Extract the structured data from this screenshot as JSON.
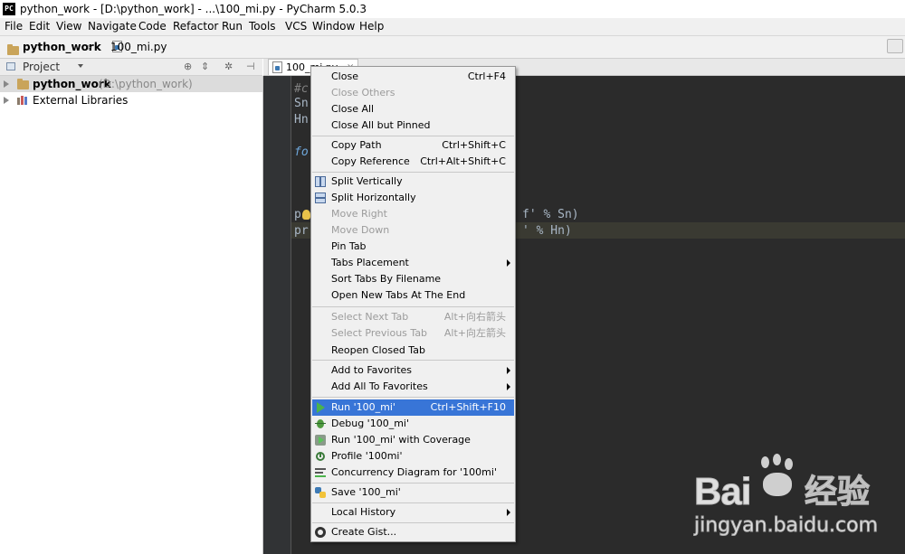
{
  "window": {
    "title": "python_work - [D:\\python_work] - ...\\100_mi.py - PyCharm 5.0.3",
    "app_icon": "PC"
  },
  "menubar": {
    "items": [
      "File",
      "Edit",
      "View",
      "Navigate",
      "Code",
      "Refactor",
      "Run",
      "Tools",
      "VCS",
      "Window",
      "Help"
    ]
  },
  "breadcrumb": {
    "project": "python_work",
    "file": "100_mi.py"
  },
  "project_panel": {
    "label": "Project",
    "tree": [
      {
        "name": "python_work",
        "path": "(D:\\python_work)"
      },
      {
        "name": "External Libraries"
      }
    ]
  },
  "editor": {
    "tab_label": "100_mi.py",
    "code_lines": [
      "#c",
      "Sn",
      "Hn",
      "",
      "fo",
      "",
      "",
      "",
      "p",
      "pr"
    ],
    "right_fragments": [
      "f' % Sn)",
      "' % Hn)"
    ]
  },
  "context_menu": {
    "groups": [
      [
        {
          "label": "Close",
          "shortcut": "Ctrl+F4"
        },
        {
          "label": "Close Others",
          "disabled": true
        },
        {
          "label": "Close All"
        },
        {
          "label": "Close All but Pinned"
        }
      ],
      [
        {
          "label": "Copy Path",
          "shortcut": "Ctrl+Shift+C"
        },
        {
          "label": "Copy Reference",
          "shortcut": "Ctrl+Alt+Shift+C"
        }
      ],
      [
        {
          "label": "Split Vertically",
          "icon": "split-vertical-icon"
        },
        {
          "label": "Split Horizontally",
          "icon": "split-horizontal-icon"
        },
        {
          "label": "Move Right",
          "disabled": true
        },
        {
          "label": "Move Down",
          "disabled": true
        },
        {
          "label": "Pin Tab"
        },
        {
          "label": "Tabs Placement",
          "submenu": true
        },
        {
          "label": "Sort Tabs By Filename"
        },
        {
          "label": "Open New Tabs At The End"
        }
      ],
      [
        {
          "label": "Select Next Tab",
          "shortcut": "Alt+向右箭头",
          "disabled": true
        },
        {
          "label": "Select Previous Tab",
          "shortcut": "Alt+向左箭头",
          "disabled": true
        },
        {
          "label": "Reopen Closed Tab"
        }
      ],
      [
        {
          "label": "Add to Favorites",
          "submenu": true
        },
        {
          "label": "Add All To Favorites",
          "submenu": true
        }
      ],
      [
        {
          "label": "Run '100_mi'",
          "shortcut": "Ctrl+Shift+F10",
          "highlighted": true,
          "icon": "run-icon"
        },
        {
          "label": "Debug '100_mi'",
          "icon": "debug-icon"
        },
        {
          "label": "Run '100_mi' with Coverage",
          "icon": "coverage-icon"
        },
        {
          "label": "Profile '100mi'",
          "icon": "profile-icon"
        },
        {
          "label": "Concurrency Diagram for  '100mi'",
          "icon": "concurrency-icon"
        }
      ],
      [
        {
          "label": "Save '100_mi'",
          "icon": "python-icon"
        }
      ],
      [
        {
          "label": "Local History",
          "submenu": true
        }
      ],
      [
        {
          "label": "Create Gist...",
          "icon": "github-icon"
        }
      ]
    ]
  },
  "watermark": {
    "brand": "Bai",
    "brand_cn": "经验",
    "url": "jingyan.baidu.com"
  },
  "colors": {
    "highlight": "#3875d7",
    "editor_bg": "#2b2b2b",
    "menu_bg": "#f0f0f0"
  }
}
